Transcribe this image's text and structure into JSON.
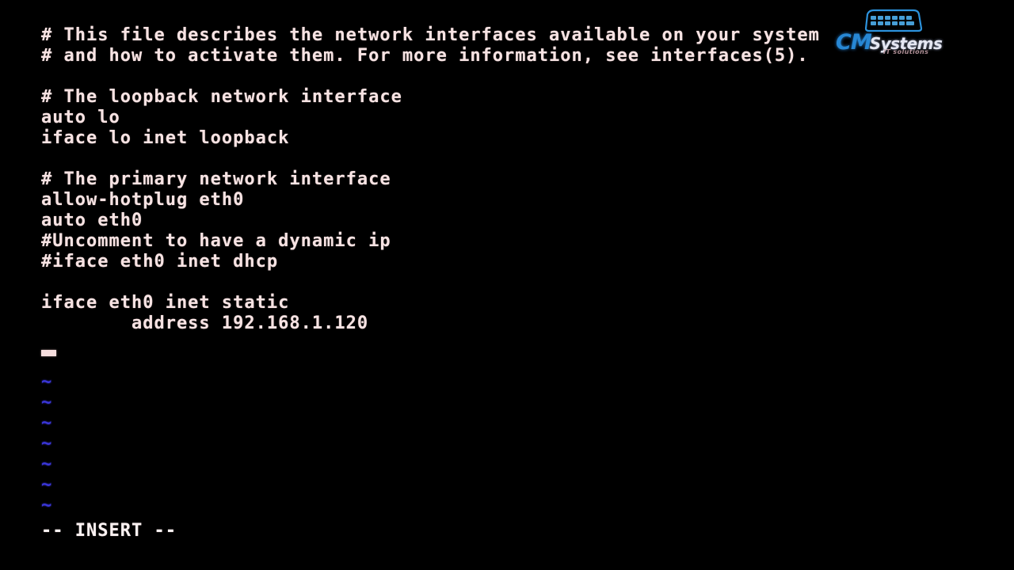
{
  "window": {
    "app": "vim",
    "background_color": "#000000",
    "text_color": "#f7e3e3",
    "tilde_color": "#3a36d8"
  },
  "editor": {
    "lines": [
      "# This file describes the network interfaces available on your system",
      "# and how to activate them. For more information, see interfaces(5).",
      "",
      "# The loopback network interface",
      "auto lo",
      "iface lo inet loopback",
      "",
      "# The primary network interface",
      "allow-hotplug eth0",
      "auto eth0",
      "#Uncomment to have a dynamic ip",
      "#iface eth0 inet dhcp",
      "",
      "iface eth0 inet static",
      "        address 192.168.1.120",
      ""
    ],
    "empty_line_markers": [
      "~",
      "~",
      "~",
      "~",
      "~",
      "~",
      "~"
    ],
    "cursor": {
      "line": 16,
      "column": 1
    }
  },
  "statusline": {
    "mode_text": "-- INSERT --"
  },
  "watermark": {
    "brand_primary": "CM",
    "brand_secondary": "Systems",
    "tagline": "IT solutions",
    "icon": "keyboard-icon",
    "primary_color": "#2a8fe0",
    "secondary_color": "#f2f4ff"
  }
}
